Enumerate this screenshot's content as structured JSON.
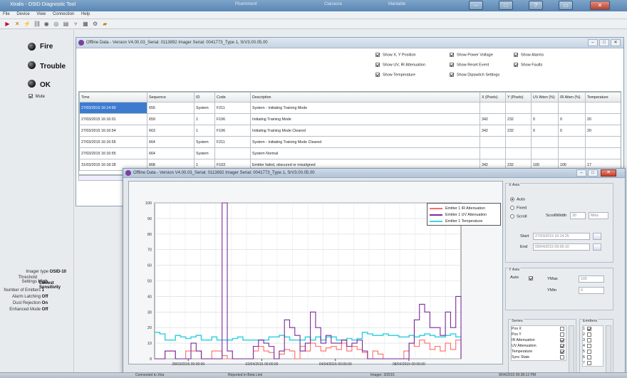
{
  "app": {
    "title": "Xtralis - OSID Diagnostic Tool",
    "tabs": [
      "Ptuemment",
      "Clanacce",
      "Maniable"
    ]
  },
  "menu": [
    "File",
    "Device",
    "View",
    "Connection",
    "Help"
  ],
  "toolbar_icons": [
    "fire-icon",
    "trouble-icon",
    "connect-icon",
    "link-icon",
    "stop-icon",
    "record-icon",
    "chart-icon",
    "filter-icon",
    "grid-icon",
    "settings-icon",
    "folder-icon"
  ],
  "status": {
    "fire": "Fire",
    "trouble": "Trouble",
    "ok": "OK",
    "mute_label": "Mute",
    "mute_checked": true
  },
  "device_info": {
    "imager_type_label": "Imager type",
    "imager_type": "OSID-10",
    "threshold_label": "Threshold Settings",
    "threshold_value_1": "High",
    "threshold_value_2": "Lowest Sensitivity",
    "emitters_label": "Number of Emitters",
    "emitters": "1",
    "alarm_latching_label": "Alarm Latching",
    "alarm_latching": "Off",
    "dust_rejection_label": "Dust Rejection",
    "dust_rejection": "On",
    "enhanced_mode_label": "Enhanced Mode",
    "enhanced_mode": "Off"
  },
  "offline_window": {
    "title": "Offline Data - Version V4.00.03_Serial: 0113892 Imager Serial: 0041773_Type 1, SrV3.00.05.00",
    "options": [
      {
        "label": "Show X, Y Position",
        "checked": true
      },
      {
        "label": "Show UV, IR Attenuation",
        "checked": true
      },
      {
        "label": "Show Temperature",
        "checked": true
      },
      {
        "label": "Show Power Voltage",
        "checked": true
      },
      {
        "label": "Show Reset Event",
        "checked": true
      },
      {
        "label": "Show Dipswitch Settings",
        "checked": true
      },
      {
        "label": "Show Alarms",
        "checked": true
      },
      {
        "label": "Show Faults",
        "checked": true
      }
    ],
    "columns": [
      "Time",
      "Sequence",
      "ID",
      "Code",
      "Description",
      "X (Pixels)",
      "Y (Pixels)",
      "UV Atten (%)",
      "IR Atten (%)",
      "Temperature"
    ],
    "rows": [
      [
        "27/03/2015 16:14:50",
        "655",
        "System",
        "F211",
        "System - Initiating Training Mode",
        "",
        "",
        "",
        "",
        ""
      ],
      [
        "27/03/2015 16:16:01",
        "659",
        "1",
        "F106",
        "Initiating Training Mode",
        "342",
        "232",
        "0",
        "0",
        "20"
      ],
      [
        "27/03/2015 16:16:54",
        "663",
        "1",
        "F106",
        "Initiating Training Mode Cleared",
        "342",
        "232",
        "0",
        "0",
        "20"
      ],
      [
        "27/03/2015 16:16:55",
        "664",
        "System",
        "F211",
        "System - Initiating Training Mode Cleared",
        "",
        "",
        "",
        "",
        ""
      ],
      [
        "27/03/2015 16:16:55",
        "664",
        "System",
        "",
        "System Normal",
        "",
        "",
        "",
        "",
        ""
      ],
      [
        "31/03/2015 16:18:28",
        "808",
        "1",
        "F103",
        "Emitter failed, obscured or misaligned",
        "342",
        "232",
        "100",
        "100",
        "17"
      ]
    ]
  },
  "chart_window": {
    "title": "Offline Data - Version V4.00.03_Serial: 0113892 Imager Serial: 0041773_Type 1, SrV3.00.05.00",
    "x_auto": {
      "title": "X Axis",
      "auto": "Auto",
      "fixed": "Fixed",
      "scroll": "Scroll",
      "selected": "Auto",
      "scroll_width_label": "ScrollWidth",
      "scroll_width_value": "30",
      "scroll_unit": "Mins",
      "start_label": "Start",
      "start_value": "27/03/2015 16:14:25",
      "end_label": "End",
      "end_value": "09/04/2015 09:00:10"
    },
    "y_auto": {
      "title": "Y Axis",
      "auto_label": "Auto",
      "auto_checked": true,
      "ymax_label": "YMax",
      "ymax_value": "100",
      "ymin_label": "YMin",
      "ymin_value": "0"
    },
    "series_list": {
      "title": "Series",
      "items": [
        {
          "label": "Pos X",
          "checked": false
        },
        {
          "label": "Pos Y",
          "checked": false
        },
        {
          "label": "IR Attenuation",
          "checked": true
        },
        {
          "label": "UV Attenuation",
          "checked": true
        },
        {
          "label": "Temperature",
          "checked": true
        },
        {
          "label": "Sync State",
          "checked": false
        }
      ]
    },
    "emitters_list": {
      "title": "Emitters",
      "items": [
        {
          "label": "1",
          "checked": true
        },
        {
          "label": "2",
          "checked": false
        },
        {
          "label": "3",
          "checked": false
        },
        {
          "label": "4",
          "checked": false
        },
        {
          "label": "5",
          "checked": false
        },
        {
          "label": "6",
          "checked": false
        },
        {
          "label": "7",
          "checked": false
        }
      ]
    }
  },
  "chart_data": {
    "type": "line",
    "ylim": [
      0,
      100
    ],
    "yticks": [
      0,
      10,
      20,
      30,
      40,
      50,
      60,
      70,
      80,
      90,
      100
    ],
    "xticks": [
      "28/03/2015 00:00:00",
      "02/04/2015 00:00:00",
      "04/04/2015 00:00:00",
      "08/04/2015 00:00:00"
    ],
    "grid": true,
    "legend_position": "top-right",
    "series": [
      {
        "name": "Emitter 1 IR Attenuation",
        "color": "#ff6a6a",
        "values": [
          0,
          0,
          5,
          5,
          0,
          0,
          5,
          5,
          5,
          0,
          0,
          5,
          5,
          2,
          0,
          0,
          0,
          0,
          0,
          5,
          8,
          5,
          4,
          0,
          3,
          6,
          5,
          0,
          8,
          5,
          10,
          8,
          5,
          7,
          8,
          6,
          10,
          5,
          8,
          6,
          4,
          0,
          5,
          3,
          0,
          0,
          0,
          0,
          5,
          10,
          8,
          12,
          10,
          6,
          8,
          5,
          10,
          6,
          12,
          0
        ]
      },
      {
        "name": "Emitter 1 UV Attenuation",
        "color": "#7b2a9a",
        "values": [
          0,
          0,
          5,
          5,
          0,
          0,
          0,
          10,
          5,
          0,
          0,
          0,
          0,
          100,
          5,
          0,
          0,
          0,
          0,
          8,
          12,
          10,
          8,
          0,
          5,
          25,
          20,
          15,
          5,
          10,
          30,
          20,
          10,
          15,
          10,
          10,
          12,
          8,
          10,
          12,
          5,
          0,
          0,
          0,
          0,
          0,
          0,
          0,
          0,
          10,
          25,
          35,
          30,
          20,
          20,
          15,
          30,
          20,
          40,
          0
        ]
      },
      {
        "name": "Emitter 1 Temperature",
        "color": "#40d4e4",
        "values": [
          17,
          16,
          12,
          12,
          15,
          14,
          13,
          14,
          15,
          12,
          12,
          14,
          12,
          12,
          12,
          13,
          14,
          12,
          12,
          12,
          12,
          12,
          14,
          14,
          15,
          14,
          12,
          12,
          12,
          14,
          12,
          14,
          12,
          14,
          14,
          12,
          12,
          13,
          12,
          13,
          17,
          16,
          15,
          15,
          16,
          15,
          15,
          14,
          14,
          15,
          14,
          15,
          16,
          15,
          14,
          14,
          15,
          16,
          14,
          14
        ]
      }
    ]
  },
  "taskbar": [
    "Connected to Xtra",
    "Reported in Beta Link",
    "Imager: 3/2015",
    "9/04/2015 09:38:12 PM"
  ]
}
